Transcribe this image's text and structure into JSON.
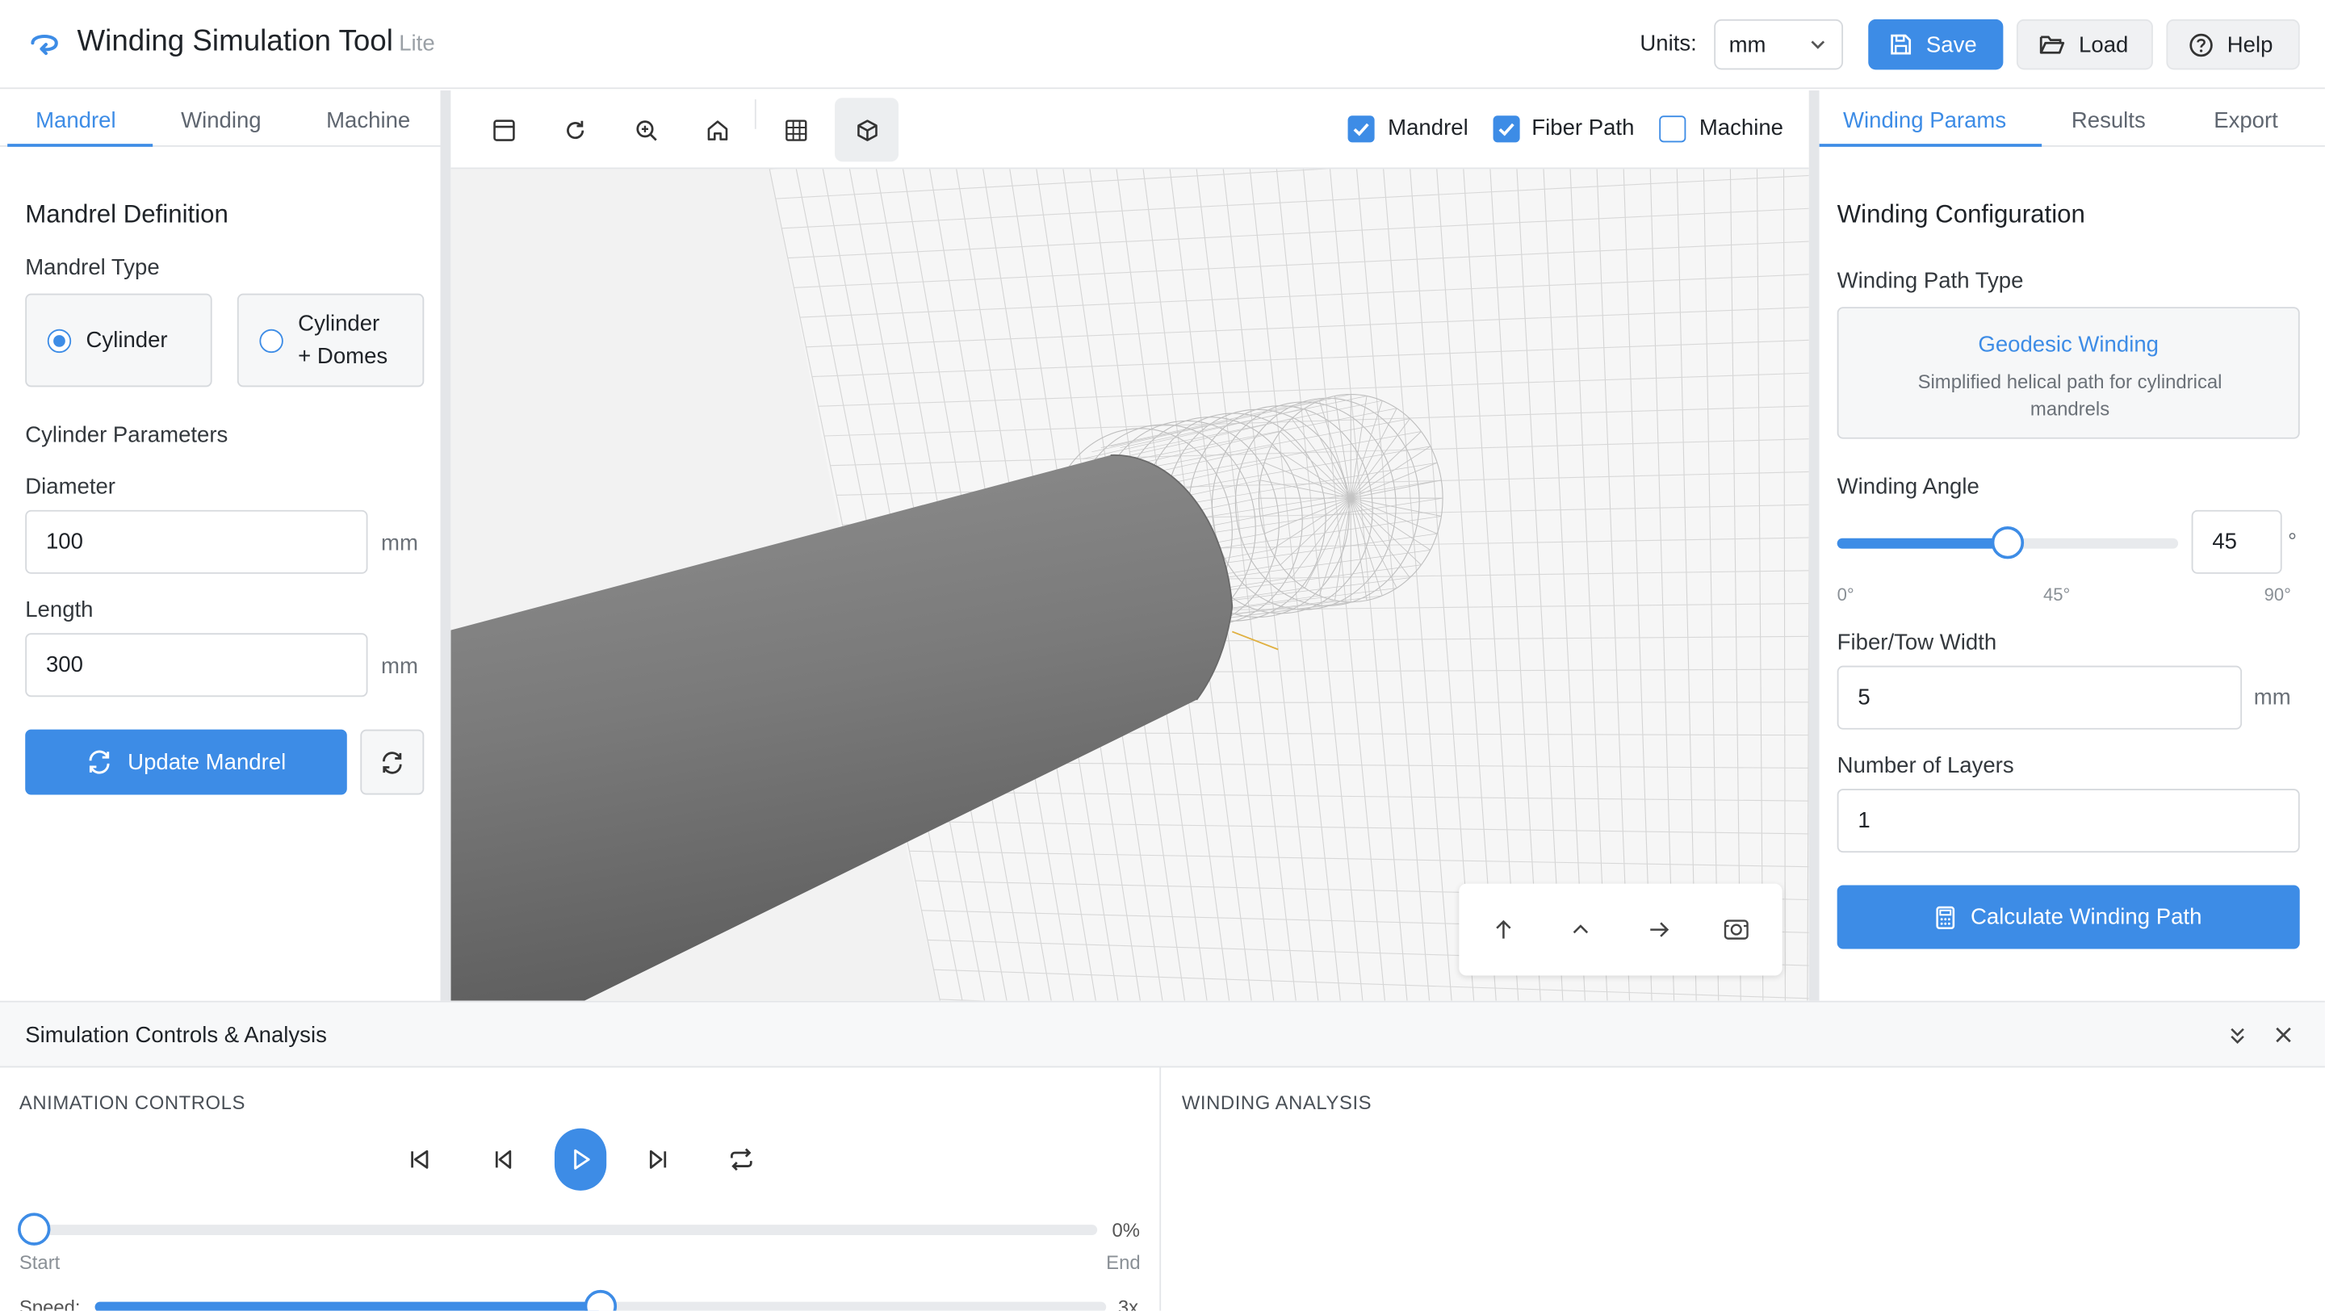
{
  "app": {
    "title": "Winding Simulation Tool",
    "edition": "Lite"
  },
  "header": {
    "units_label": "Units:",
    "units_value": "mm",
    "save_label": "Save",
    "load_label": "Load",
    "help_label": "Help"
  },
  "left_panel": {
    "tabs": [
      "Mandrel",
      "Winding",
      "Machine"
    ],
    "active_tab": "Mandrel",
    "section_title": "Mandrel Definition",
    "mandrel_type_label": "Mandrel Type",
    "type_options": [
      "Cylinder",
      "Cylinder",
      "+ Domes"
    ],
    "selected_type": "Cylinder",
    "params_title": "Cylinder Parameters",
    "diameter_label": "Diameter",
    "diameter_value": "100",
    "diameter_unit": "mm",
    "length_label": "Length",
    "length_value": "300",
    "length_unit": "mm",
    "update_button": "Update Mandrel"
  },
  "viewport": {
    "toggles": [
      {
        "label": "Mandrel",
        "checked": true
      },
      {
        "label": "Fiber Path",
        "checked": true
      },
      {
        "label": "Machine",
        "checked": false
      }
    ]
  },
  "right_panel": {
    "tabs": [
      "Winding Params",
      "Results",
      "Export"
    ],
    "active_tab": "Winding Params",
    "section_title": "Winding Configuration",
    "path_type_label": "Winding Path Type",
    "path_type_name": "Geodesic Winding",
    "path_type_desc": "Simplified helical path for cylindrical mandrels",
    "angle_label": "Winding Angle",
    "angle_value": "45",
    "angle_unit": "°",
    "angle_fraction": 0.5,
    "angle_ticks": [
      "0°",
      "45°",
      "90°"
    ],
    "tow_label": "Fiber/Tow Width",
    "tow_value": "5",
    "tow_unit": "mm",
    "layers_label": "Number of Layers",
    "layers_value": "1",
    "calculate_button": "Calculate Winding Path"
  },
  "bottom": {
    "title": "Simulation Controls & Analysis",
    "animation_title": "ANIMATION CONTROLS",
    "analysis_title": "WINDING ANALYSIS",
    "progress_value": "0%",
    "progress_fraction": 0,
    "start_label": "Start",
    "end_label": "End",
    "speed_label": "Speed:",
    "speed_max": "3x",
    "speed_fraction": 0.5
  },
  "colors": {
    "accent": "#3d8ce6",
    "mandrel": "#7a7a7a",
    "grid": "#d0d0d0"
  }
}
